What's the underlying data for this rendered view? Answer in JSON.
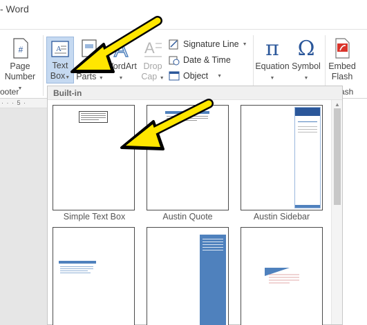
{
  "window": {
    "title": "- Word"
  },
  "ribbon": {
    "page_number": {
      "line1": "Page",
      "line2": "Number"
    },
    "footer_group_label": "ooter",
    "text_box": {
      "line1": "Text",
      "line2": "Box"
    },
    "quick_parts": {
      "line1": "Quick",
      "line2": "Parts"
    },
    "wordart": {
      "label": "WordArt"
    },
    "drop_cap": {
      "line1": "Drop",
      "line2": "Cap"
    },
    "signature_line": "Signature Line",
    "date_time": "Date & Time",
    "object": "Object",
    "equation": "Equation",
    "symbol": "Symbol",
    "embed_flash": {
      "line1": "Embed",
      "line2": "Flash"
    },
    "flash_group_label": "ash"
  },
  "ruler": {
    "text": "· · · 5 ·"
  },
  "gallery": {
    "header": "Built-in",
    "items": [
      {
        "label": "Simple Text Box"
      },
      {
        "label": "Austin Quote"
      },
      {
        "label": "Austin Sidebar"
      },
      {
        "label": ""
      },
      {
        "label": ""
      },
      {
        "label": ""
      }
    ]
  },
  "colors": {
    "accent_blue": "#2b579a",
    "selected_bg": "#c5d9f1",
    "arrow_yellow": "#ffe600",
    "thumb_blue": "#4f81bd"
  }
}
